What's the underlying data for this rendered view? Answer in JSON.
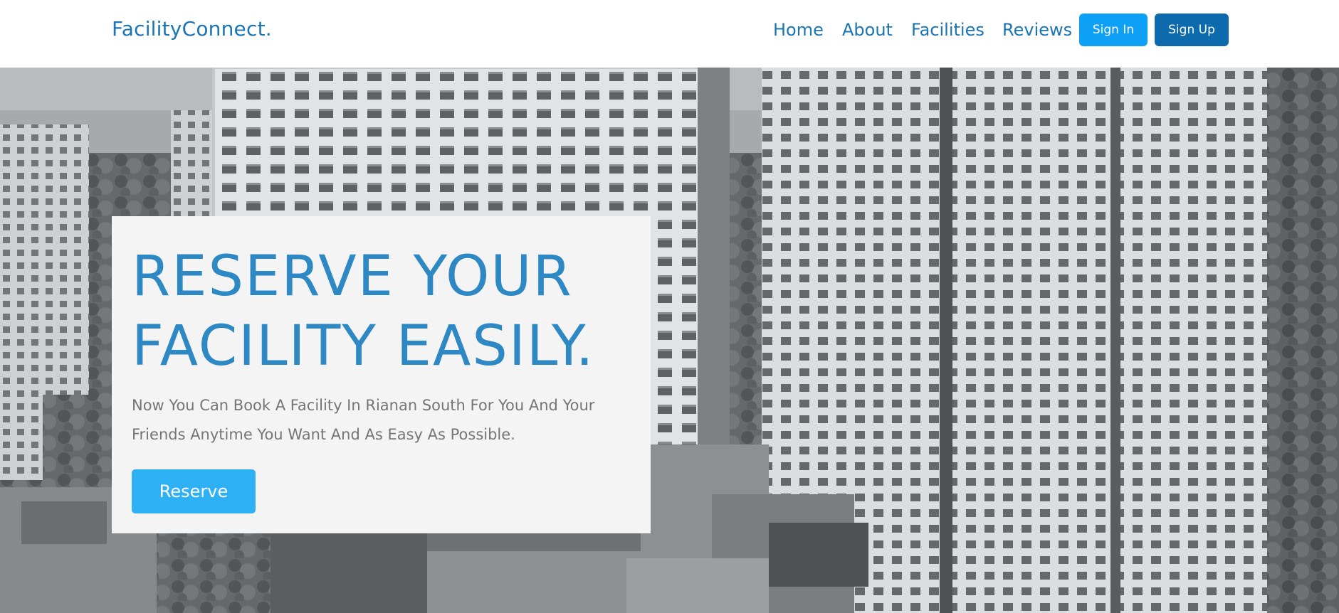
{
  "brand": {
    "logo_text": "FacilityConnect."
  },
  "nav": {
    "links": [
      "Home",
      "About",
      "Facilities",
      "Reviews"
    ],
    "sign_in": "Sign In",
    "sign_up": "Sign Up"
  },
  "hero": {
    "headline_line1": "RESERVE YOUR",
    "headline_line2": "FACILITY EASILY.",
    "subtitle": "Now You Can Book A Facility In Rianan South For You And Your Friends Anytime You Want And As Easy As Possible.",
    "cta": "Reserve"
  },
  "colors": {
    "brand": "#1b75b5",
    "headline": "#2d88c4",
    "sign_in_bg": "#0ea0f5",
    "sign_up_bg": "#0d6aac",
    "cta_bg": "#2eb0f5"
  }
}
